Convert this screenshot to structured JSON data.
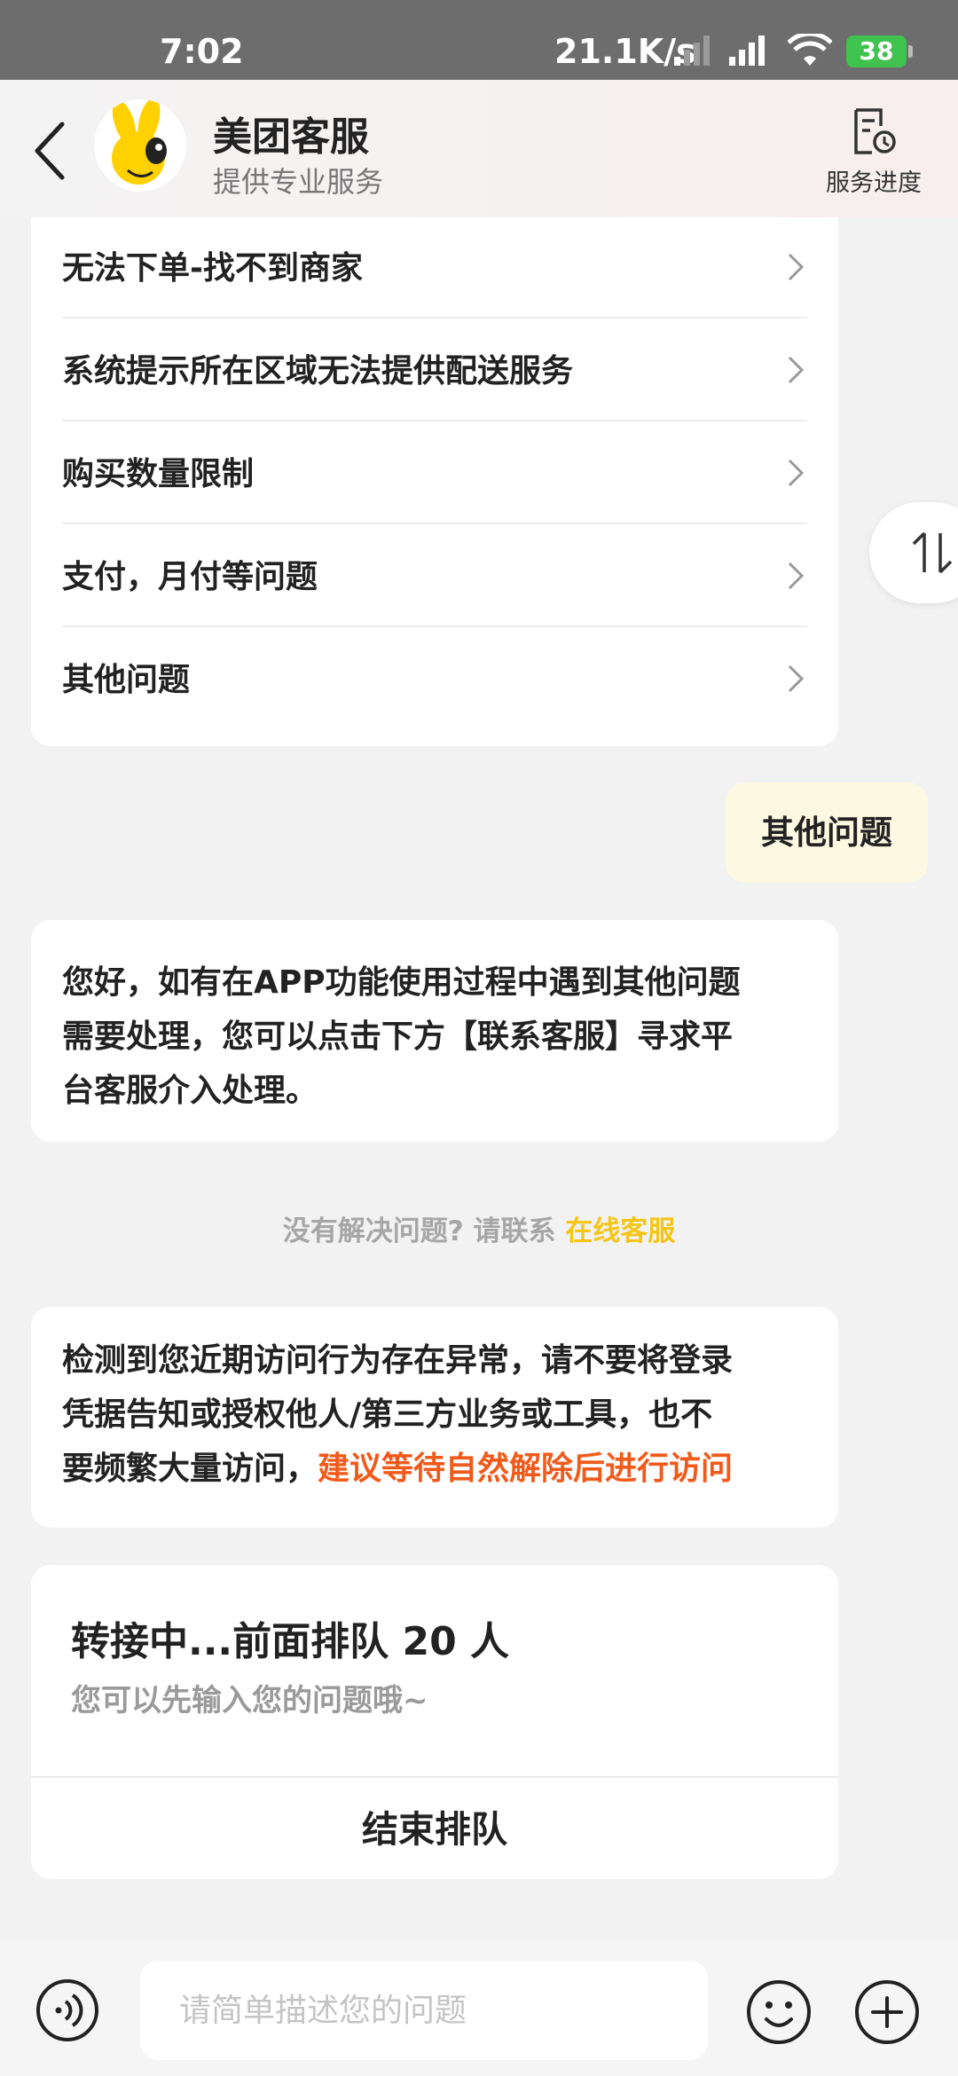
{
  "status_bar": {
    "time": "7:02",
    "network_speed": "21.1K/s",
    "battery": "38"
  },
  "header": {
    "title": "美团客服",
    "subtitle": "提供专业服务",
    "progress_label": "服务进度"
  },
  "menu": {
    "items": [
      {
        "label": "无法下单-找不到商家"
      },
      {
        "label": "系统提示所在区域无法提供配送服务"
      },
      {
        "label": "购买数量限制"
      },
      {
        "label": "支付，月付等问题"
      },
      {
        "label": "其他问题"
      }
    ]
  },
  "chat": {
    "user_message": "其他问题",
    "bot_reply_lines": [
      "您好，如有在APP功能使用过程中遇到其他问题",
      "需要处理，您可以点击下方【联系客服】寻求平",
      "台客服介入处理。"
    ],
    "hint_prefix": "没有解决问题? 请联系",
    "hint_link": "在线客服",
    "warning_line1": "检测到您近期访问行为存在异常，请不要将登录",
    "warning_line2": "凭据告知或授权他人/第三方业务或工具，也不",
    "warning_line3_prefix": "要频繁大量访问，",
    "warning_line3_highlight": "建议等待自然解除后进行访问"
  },
  "queue": {
    "title": "转接中...前面排队 20 人",
    "subtitle": "您可以先输入您的问题哦~",
    "end_label": "结束排队"
  },
  "input_bar": {
    "placeholder": "请简单描述您的问题"
  },
  "colors": {
    "link_yellow": "#f5c518",
    "warning_orange": "#f05a1b",
    "user_bubble": "#fcf8e1"
  }
}
